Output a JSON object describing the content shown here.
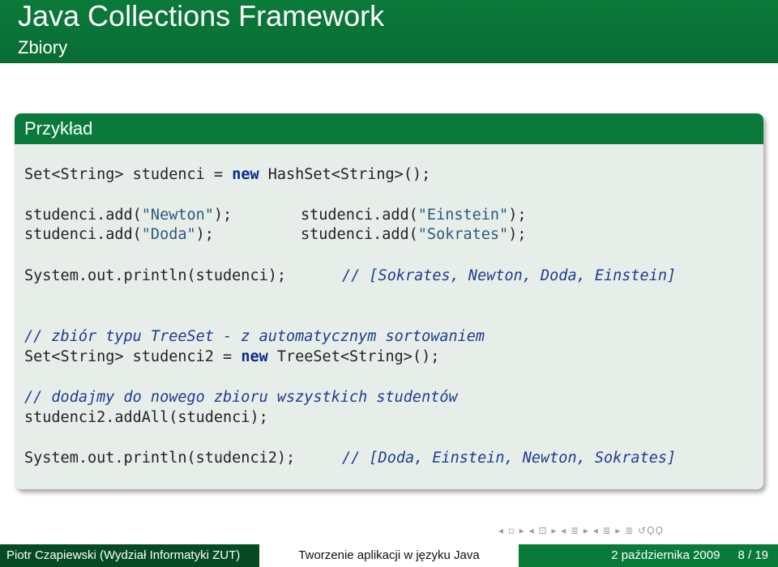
{
  "slide": {
    "title": "Java Collections Framework",
    "subtitle": "Zbiory"
  },
  "block": {
    "title": "Przykład",
    "code": {
      "l1": {
        "a": "Set<String> studenci = ",
        "kw": "new",
        "b": " HashSet<String>();"
      },
      "l2": {
        "a": "studenci.add(",
        "s": "\"Newton\"",
        "b": ");"
      },
      "l2r": {
        "a": "studenci.add(",
        "s": "\"Einstein\"",
        "b": ");"
      },
      "l3": {
        "a": "studenci.add(",
        "s": "\"Doda\"",
        "b": ");"
      },
      "l3r": {
        "a": "studenci.add(",
        "s": "\"Sokrates\"",
        "b": ");"
      },
      "l4": {
        "a": "System.out.println(studenci);",
        "c": "// [Sokrates, Newton, Doda, Einstein]"
      },
      "l5": {
        "c": "// zbiór typu TreeSet - z automatycznym sortowaniem"
      },
      "l6": {
        "a": "Set<String> studenci2 = ",
        "kw": "new",
        "b": " TreeSet<String>();"
      },
      "l7": {
        "c": "// dodajmy do nowego zbioru wszystkich studentów"
      },
      "l8": {
        "a": "studenci2.addAll(studenci);"
      },
      "l9": {
        "a": "System.out.println(studenci2);",
        "c": "// [Doda, Einstein, Newton, Sokrates]"
      }
    }
  },
  "nav": {
    "symbols": "◂ ▫ ▸ ◂ ⊡ ▸ ◂ ≣ ▸ ◂ ≣ ▸ ≣ ↺ϘϘ"
  },
  "footer": {
    "author": "Piotr Czapiewski (Wydział Informatyki ZUT)",
    "course": "Tworzenie aplikacji w języku Java",
    "date": "2 października 2009",
    "page": "8 / 19"
  },
  "colors": {
    "primary": "#0a7a3a",
    "dark": "#054a22",
    "block_bg": "#e7eeea",
    "keyword": "#0a2a8c",
    "comment": "#1d3c8c"
  }
}
